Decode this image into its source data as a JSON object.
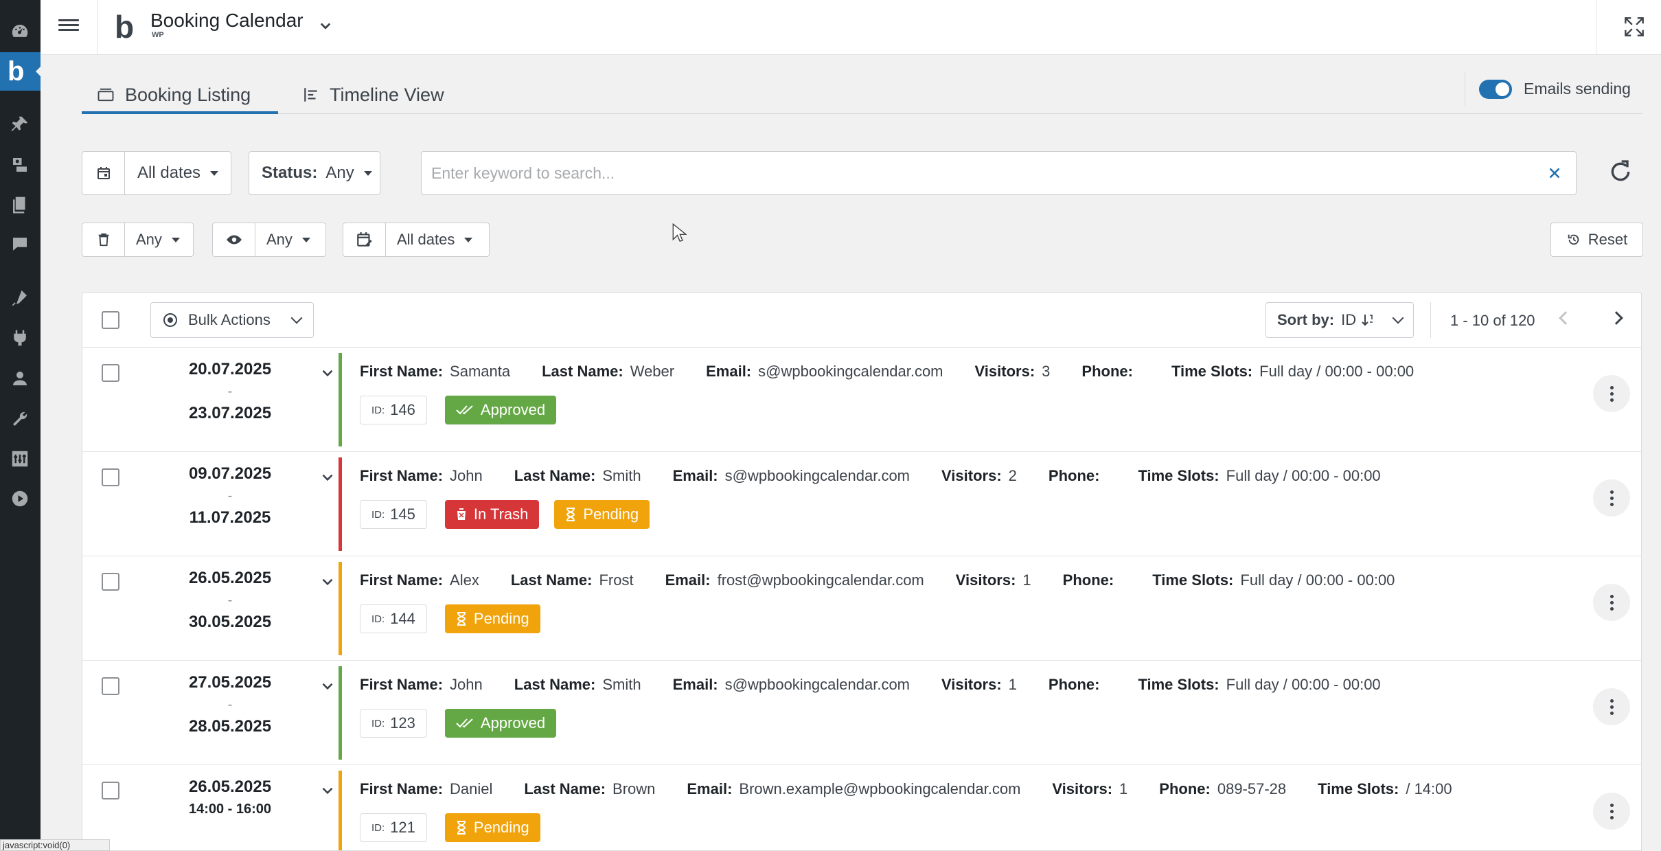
{
  "wp_sidebar": {
    "icons": [
      "dashboard-icon",
      "booking-calendar-icon",
      "pin-icon",
      "media-icon",
      "pages-icon",
      "comments-icon",
      "appearance-icon",
      "plugins-icon",
      "users-icon",
      "tools-icon",
      "settings-icon",
      "media-play-icon"
    ]
  },
  "header": {
    "brand_title": "Booking Calendar",
    "brand_sub": "WP"
  },
  "tabs": {
    "booking_listing": "Booking Listing",
    "timeline_view": "Timeline View",
    "emails_sending": "Emails sending",
    "emails_sending_on": true
  },
  "filters": {
    "dates": "All dates",
    "status_label": "Status:",
    "status_value": "Any",
    "search_placeholder": "Enter keyword to search...",
    "trash_value": "Any",
    "read_value": "Any",
    "creation_dates": "All dates",
    "reset_label": "Reset"
  },
  "list_header": {
    "bulk_actions": "Bulk Actions",
    "sort_label": "Sort by:",
    "sort_value": "ID",
    "pager": "1 - 10 of 120"
  },
  "labels": {
    "first_name": "First Name:",
    "last_name": "Last Name:",
    "email": "Email:",
    "visitors": "Visitors:",
    "phone": "Phone:",
    "time_slots": "Time Slots:",
    "id": "ID:",
    "dash": "-"
  },
  "bookings": [
    {
      "start": "20.07.2025",
      "end": "23.07.2025",
      "first_name": "Samanta",
      "last_name": "Weber",
      "email": "s@wpbookingcalendar.com",
      "visitors": "3",
      "phone": "",
      "time_slots": "Full day / 00:00 - 00:00",
      "id": "146",
      "statuses": [
        "Approved"
      ],
      "unread": false
    },
    {
      "start": "09.07.2025",
      "end": "11.07.2025",
      "first_name": "John",
      "last_name": "Smith",
      "email": "s@wpbookingcalendar.com",
      "visitors": "2",
      "phone": "",
      "time_slots": "Full day / 00:00 - 00:00",
      "id": "145",
      "statuses": [
        "In Trash",
        "Pending"
      ],
      "unread": true
    },
    {
      "start": "26.05.2025",
      "end": "30.05.2025",
      "first_name": "Alex",
      "last_name": "Frost",
      "email": "frost@wpbookingcalendar.com",
      "visitors": "1",
      "phone": "",
      "time_slots": "Full day / 00:00 - 00:00",
      "id": "144",
      "statuses": [
        "Pending"
      ],
      "unread": true
    },
    {
      "start": "27.05.2025",
      "end": "28.05.2025",
      "first_name": "John",
      "last_name": "Smith",
      "email": "s@wpbookingcalendar.com",
      "visitors": "1",
      "phone": "",
      "time_slots": "Full day / 00:00 - 00:00",
      "id": "123",
      "statuses": [
        "Approved"
      ],
      "unread": true
    },
    {
      "start": "26.05.2025",
      "time": "14:00 - 16:00",
      "first_name": "Daniel",
      "last_name": "Brown",
      "email": "Brown.example@wpbookingcalendar.com",
      "visitors": "1",
      "phone": "089-57-28",
      "time_slots": "/ 14:00",
      "id": "121",
      "statuses": [
        "Pending"
      ],
      "unread": false
    }
  ],
  "colors": {
    "approved": "#64a845",
    "trash": "#d63638",
    "pending": "#f0a30a",
    "accent": "#2271b1"
  },
  "status_text": "javascript:void(0)"
}
